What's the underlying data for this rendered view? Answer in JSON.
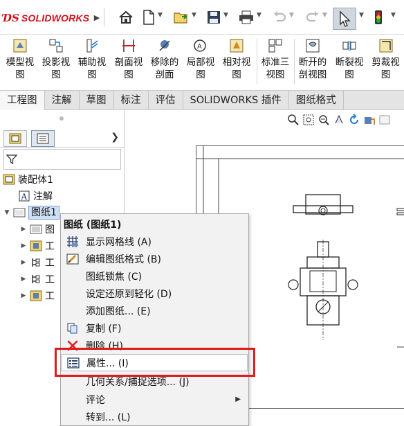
{
  "app": {
    "brand": "SOLIDWORKS"
  },
  "ribbon": {
    "buttons": [
      {
        "label1": "模型视",
        "label2": "图"
      },
      {
        "label1": "投影视",
        "label2": "图"
      },
      {
        "label1": "辅助视",
        "label2": "图"
      },
      {
        "label1": "剖面视",
        "label2": "图"
      },
      {
        "label1": "移除的",
        "label2": "剖面"
      },
      {
        "label1": "局部视",
        "label2": "图"
      },
      {
        "label1": "相对视",
        "label2": "图"
      },
      {
        "label1": "标准三",
        "label2": "视图"
      },
      {
        "label1": "断开的",
        "label2": "剖视图"
      },
      {
        "label1": "断裂视",
        "label2": "图"
      },
      {
        "label1": "剪裁视",
        "label2": "图"
      }
    ]
  },
  "tabs": [
    {
      "label": "工程图"
    },
    {
      "label": "注解"
    },
    {
      "label": "草图"
    },
    {
      "label": "标注"
    },
    {
      "label": "评估"
    },
    {
      "label": "SOLIDWORKS 插件"
    },
    {
      "label": "图纸格式"
    }
  ],
  "tree": {
    "root": "装配体1",
    "annotations": "注解",
    "sheet": "图纸1",
    "children": [
      {
        "label": "图"
      },
      {
        "label": "工"
      },
      {
        "label": "工"
      },
      {
        "label": "工"
      },
      {
        "label": "工"
      }
    ]
  },
  "context_menu": {
    "title": "图纸 (图纸1)",
    "items": [
      {
        "label": "显示网格线 (A)",
        "icon": "grid-icon"
      },
      {
        "label": "编辑图纸格式 (B)",
        "icon": "edit-sheet-format-icon"
      },
      {
        "label": "图纸锁焦 (C)",
        "icon": ""
      },
      {
        "label": "设定还原到轻化 (D)",
        "icon": ""
      },
      {
        "label": "添加图纸... (E)",
        "icon": ""
      },
      {
        "label": "复制 (F)",
        "icon": "copy-icon"
      },
      {
        "label": "删除 (H)",
        "icon": "delete-icon"
      },
      {
        "label": "属性... (I)",
        "icon": "properties-icon"
      },
      {
        "label": "几何关系/捕捉选项... (J)",
        "icon": ""
      },
      {
        "label": "评论",
        "icon": ""
      },
      {
        "label": "转到... (L)",
        "icon": ""
      }
    ]
  },
  "colors": {
    "brand_red": "#d1111b",
    "highlight_red": "#e01a1a",
    "tree_selection": "#cde0f5"
  }
}
